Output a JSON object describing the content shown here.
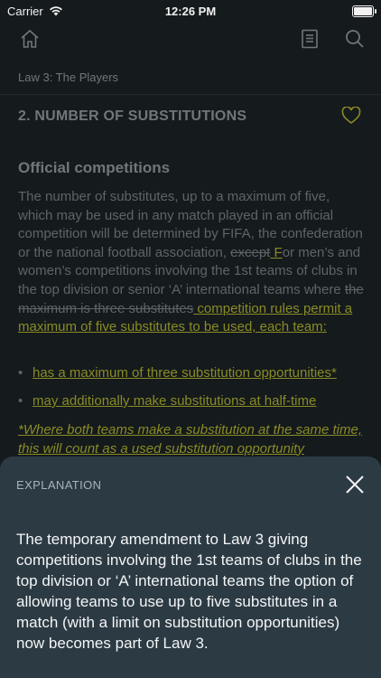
{
  "status_bar": {
    "carrier": "Carrier",
    "time": "12:26 PM"
  },
  "nav": {
    "icons": [
      "home-icon",
      "book-icon",
      "search-icon"
    ]
  },
  "breadcrumb": "Law 3: The Players",
  "section": {
    "title": "2. NUMBER OF SUBSTITUTIONS",
    "favorite_icon": "heart-icon"
  },
  "content": {
    "heading": "Official competitions",
    "para_1": "The number of substitutes, up to a maximum of five, which may be used in any match played in an official competition will be determined by FIFA, the confederation or the national football association, ",
    "struck_1": "except",
    "amend_1": " F",
    "para_2": "or men’s and women’s competitions involving the 1st teams of clubs in the top division or senior ‘A’ international teams where ",
    "struck_2": "the maximum is three substitutes",
    "amend_2": " competition rules permit a maximum of five substitutes to be used, each team:",
    "bullets": [
      "has a maximum of three substitution opportunities*",
      "may additionally make substitutions at half-time"
    ],
    "note": "*Where both teams make a substitution at the same time, this will count as a used substitution opportunity"
  },
  "explanation": {
    "label": "EXPLANATION",
    "text": "The temporary amendment to Law 3 giving competitions involving the 1st teams of clubs in the top division or ‘A’ international teams the option of allowing teams to use up to five substitutes in a match (with a limit on substitution opportunities) now becomes part of Law 3."
  },
  "colors": {
    "background": "#151a1d",
    "amendment": "#8a8c24",
    "sheet": "#2c3a43"
  }
}
